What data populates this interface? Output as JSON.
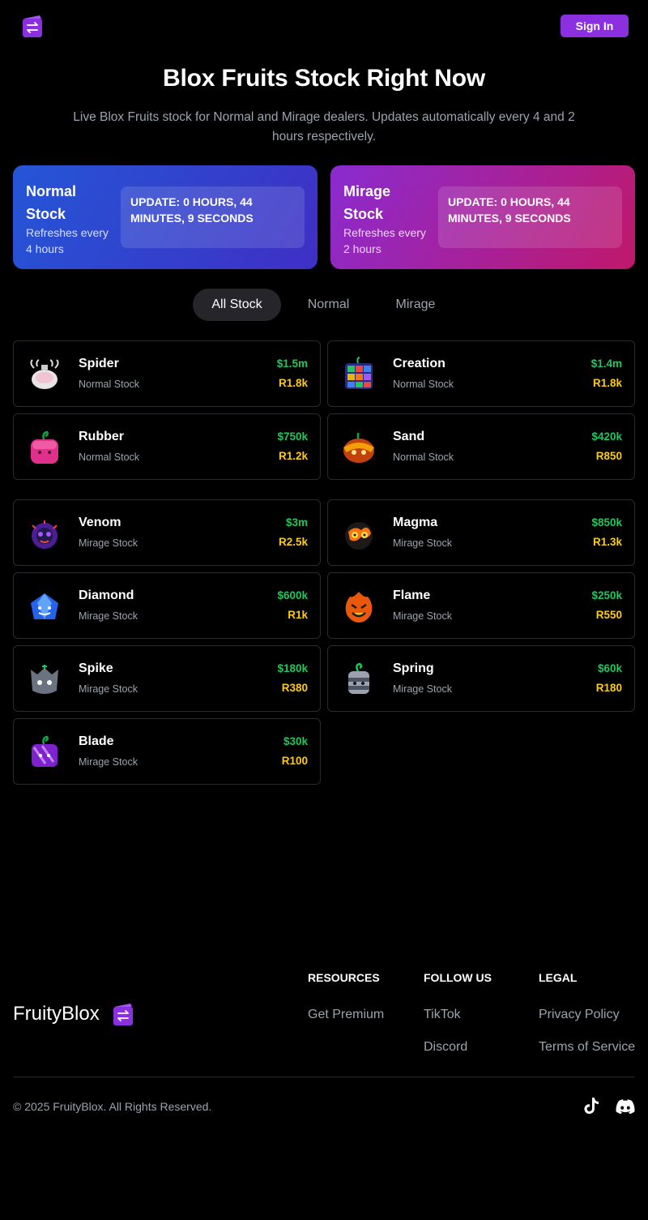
{
  "header": {
    "signin_label": "Sign In",
    "logo_icon": "swap-icon"
  },
  "hero": {
    "title": "Blox Fruits Stock Right Now",
    "subtitle": "Live Blox Fruits stock for Normal and Mirage dealers. Updates automatically every 4 and 2 hours respectively."
  },
  "stocks": {
    "normal": {
      "name": "Normal Stock",
      "refresh": "Refreshes every 4 hours",
      "timer": "Update: 0 hours, 44 minutes, 9 seconds"
    },
    "mirage": {
      "name": "Mirage Stock",
      "refresh": "Refreshes every 2 hours",
      "timer": "Update: 0 hours, 44 minutes, 9 seconds"
    }
  },
  "tabs": [
    {
      "label": "All Stock"
    },
    {
      "label": "Normal"
    },
    {
      "label": "Mirage"
    }
  ],
  "fruits": [
    {
      "name": "Spider",
      "type": "Normal Stock",
      "price": "$1.5m",
      "robux": "R1.8k",
      "icon": "spider-fruit-icon"
    },
    {
      "name": "Creation",
      "type": "Normal Stock",
      "price": "$1.4m",
      "robux": "R1.8k",
      "icon": "creation-fruit-icon"
    },
    {
      "name": "Rubber",
      "type": "Normal Stock",
      "price": "$750k",
      "robux": "R1.2k",
      "icon": "rubber-fruit-icon"
    },
    {
      "name": "Sand",
      "type": "Normal Stock",
      "price": "$420k",
      "robux": "R850",
      "icon": "sand-fruit-icon"
    },
    {
      "name": "Venom",
      "type": "Mirage Stock",
      "price": "$3m",
      "robux": "R2.5k",
      "icon": "venom-fruit-icon"
    },
    {
      "name": "Magma",
      "type": "Mirage Stock",
      "price": "$850k",
      "robux": "R1.3k",
      "icon": "magma-fruit-icon"
    },
    {
      "name": "Diamond",
      "type": "Mirage Stock",
      "price": "$600k",
      "robux": "R1k",
      "icon": "diamond-fruit-icon"
    },
    {
      "name": "Flame",
      "type": "Mirage Stock",
      "price": "$250k",
      "robux": "R550",
      "icon": "flame-fruit-icon"
    },
    {
      "name": "Spike",
      "type": "Mirage Stock",
      "price": "$180k",
      "robux": "R380",
      "icon": "spike-fruit-icon"
    },
    {
      "name": "Spring",
      "type": "Mirage Stock",
      "price": "$60k",
      "robux": "R180",
      "icon": "spring-fruit-icon"
    },
    {
      "name": "Blade",
      "type": "Mirage Stock",
      "price": "$30k",
      "robux": "R100",
      "icon": "blade-fruit-icon"
    }
  ],
  "footer": {
    "brand": "FruityBlox",
    "resources": {
      "heading": "RESOURCES",
      "links": [
        "Get Premium"
      ]
    },
    "follow": {
      "heading": "FOLLOW US",
      "links": [
        "TikTok",
        "Discord"
      ]
    },
    "legal": {
      "heading": "LEGAL",
      "links": [
        "Privacy Policy",
        "Terms of Service"
      ]
    },
    "copyright": "© 2025 FruityBlox. All Rights Reserved."
  },
  "colors": {
    "accent": "#8b2fe0",
    "price": "#22c55e",
    "robux": "#facc15",
    "muted": "#9ca3af"
  }
}
